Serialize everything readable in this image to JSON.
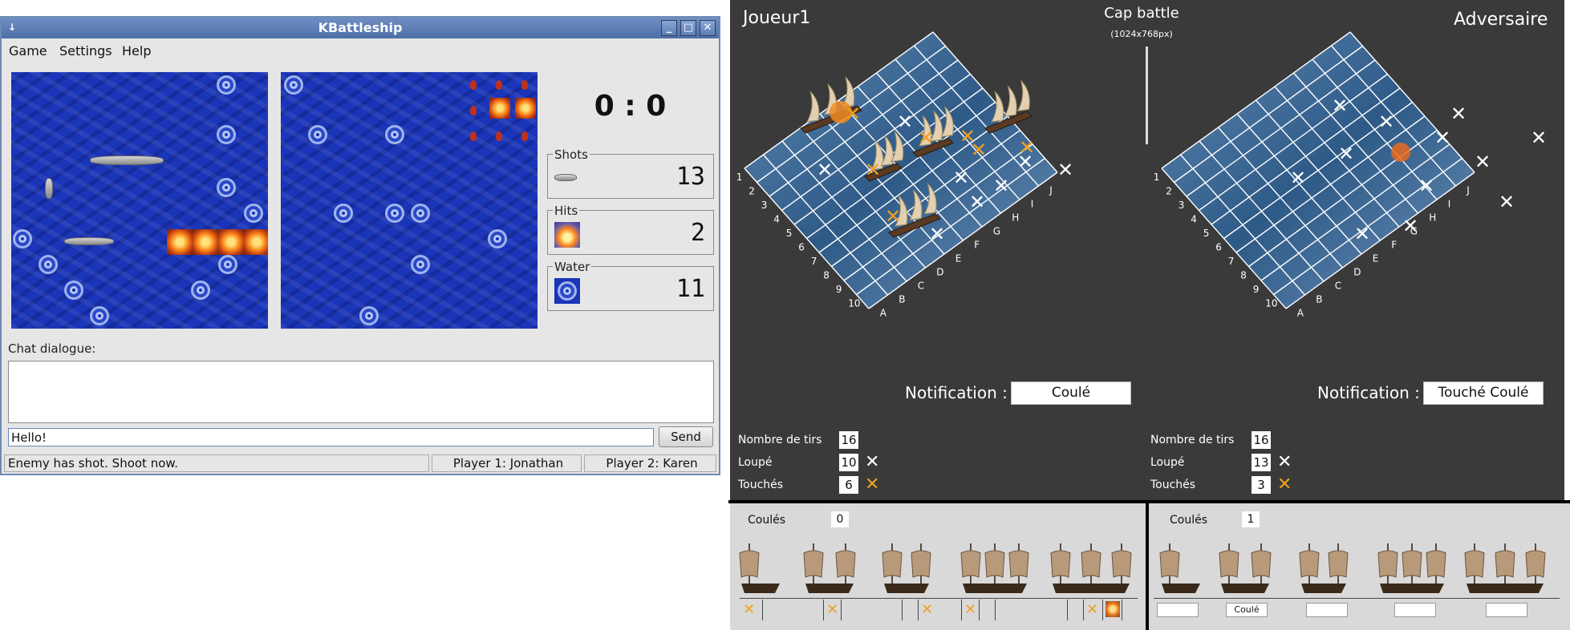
{
  "left_window": {
    "app_icon": "↓",
    "title": "KBattleship",
    "window_buttons": [
      "minimize-icon",
      "maximize-icon",
      "close-icon"
    ],
    "window_glyphs": [
      "_",
      "□",
      "✕"
    ],
    "menu": [
      "Game",
      "Settings",
      "Help"
    ],
    "score": "0 : 0",
    "stats": [
      {
        "label": "Shots",
        "icon": "ship-icon",
        "value": "13"
      },
      {
        "label": "Hits",
        "icon": "explosion-icon",
        "value": "2"
      },
      {
        "label": "Water",
        "icon": "water-splash-icon",
        "value": "11"
      }
    ],
    "chat_label": "Chat dialogue:",
    "chat_input_value": "Hello!",
    "send_label": "Send",
    "status": [
      "Enemy has shot. Shoot now.",
      "Player 1: Jonathan",
      "Player 2: Karen"
    ]
  },
  "right_panel": {
    "player_left": "Joueur1",
    "title": "Cap battle",
    "subtitle": "(1024x768px)",
    "player_right": "Adversaire",
    "grid_rows": [
      "1",
      "2",
      "3",
      "4",
      "5",
      "6",
      "7",
      "8",
      "9",
      "10"
    ],
    "grid_cols": [
      "A",
      "B",
      "C",
      "D",
      "E",
      "F",
      "G",
      "H",
      "I",
      "J"
    ],
    "left": {
      "notification_label": "Notification :",
      "notification": "Coulé",
      "stats": [
        {
          "label": "Nombre de tirs",
          "value": "16",
          "marker": ""
        },
        {
          "label": "Loupé",
          "value": "10",
          "marker": "✕"
        },
        {
          "label": "Touchés",
          "value": "6",
          "marker": "✕"
        }
      ],
      "sunk_label": "Coulés",
      "sunk_value": "0"
    },
    "right": {
      "notification_label": "Notification :",
      "notification": "Touché Coulé",
      "stats": [
        {
          "label": "Nombre de tirs",
          "value": "16",
          "marker": ""
        },
        {
          "label": "Loupé",
          "value": "13",
          "marker": "✕"
        },
        {
          "label": "Touchés",
          "value": "3",
          "marker": "✕"
        }
      ],
      "sunk_label": "Coulés",
      "sunk_value": "1",
      "ship_status": [
        "",
        "Coulé",
        "",
        "",
        ""
      ]
    },
    "colors": {
      "background": "#3a3a3a",
      "hit": "#f0a020",
      "miss": "#ffffff",
      "sea": "#2f5d8c"
    }
  }
}
